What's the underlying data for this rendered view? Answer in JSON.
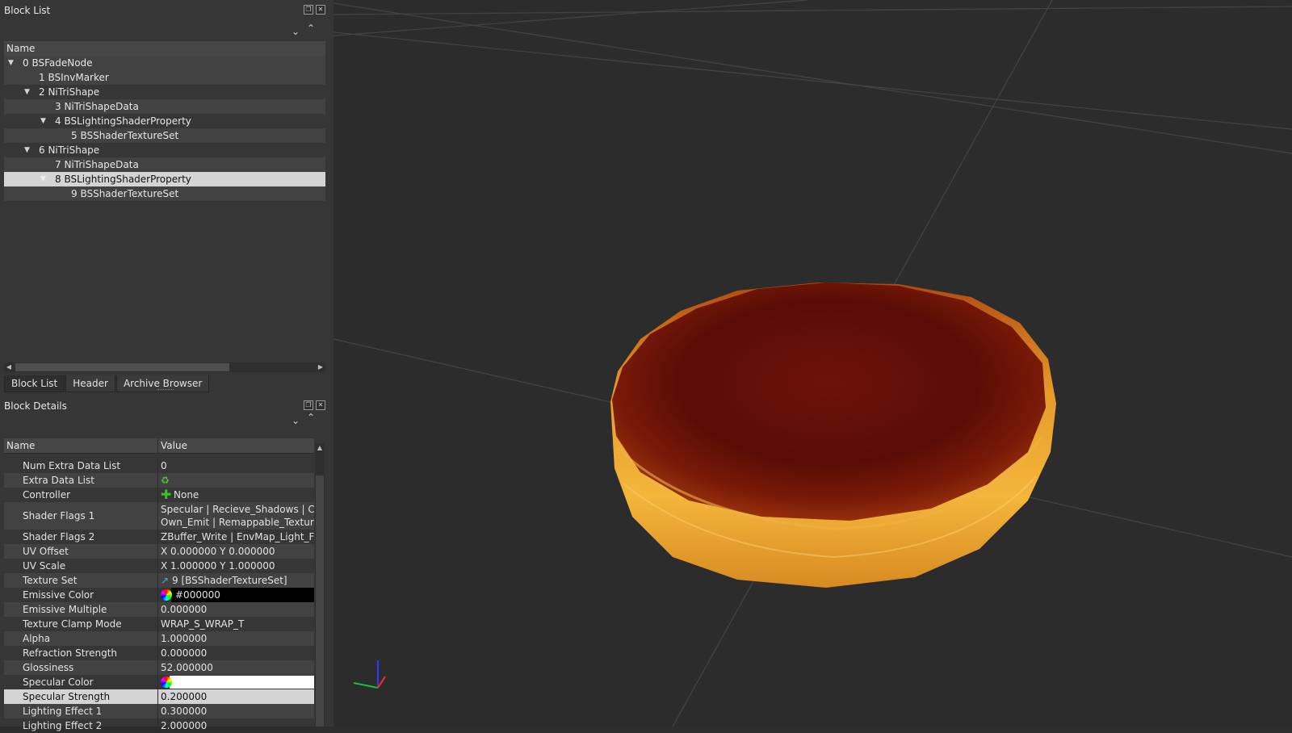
{
  "block_list": {
    "title": "Block List",
    "column_header": "Name",
    "items": [
      {
        "label": "0 BSFadeNode",
        "expanded": true
      },
      {
        "label": "1 BSInvMarker"
      },
      {
        "label": "2 NiTriShape",
        "expanded": true
      },
      {
        "label": "3 NiTriShapeData"
      },
      {
        "label": "4 BSLightingShaderProperty",
        "expanded": true
      },
      {
        "label": "5 BSShaderTextureSet"
      },
      {
        "label": "6 NiTriShape",
        "expanded": true
      },
      {
        "label": "7 NiTriShapeData"
      },
      {
        "label": "8 BSLightingShaderProperty",
        "expanded": true,
        "selected": true
      },
      {
        "label": "9 BSShaderTextureSet"
      }
    ],
    "tabs": [
      "Block List",
      "Header",
      "Archive Browser"
    ],
    "active_tab": "Block List"
  },
  "block_details": {
    "title": "Block Details",
    "columns": {
      "name": "Name",
      "value": "Value"
    },
    "rows": [
      {
        "name": "Num Extra Data List",
        "value": "0"
      },
      {
        "name": "Extra Data List",
        "value": ""
      },
      {
        "name": "Controller",
        "value": "None"
      },
      {
        "name": "Shader Flags 1",
        "value": "Specular | Recieve_Shadows | Cast_Sh",
        "value2": "Own_Emit | Remappable_Textures | Z"
      },
      {
        "name": "Shader Flags 2",
        "value": "ZBuffer_Write | EnvMap_Light_Fade"
      },
      {
        "name": "UV Offset",
        "value": "X 0.000000 Y 0.000000"
      },
      {
        "name": "UV Scale",
        "value": "X 1.000000 Y 1.000000"
      },
      {
        "name": "Texture Set",
        "value": "9 [BSShaderTextureSet]"
      },
      {
        "name": "Emissive Color",
        "value": "#000000",
        "swatch": "#000000"
      },
      {
        "name": "Emissive Multiple",
        "value": "0.000000"
      },
      {
        "name": "Texture Clamp Mode",
        "value": "WRAP_S_WRAP_T"
      },
      {
        "name": "Alpha",
        "value": "1.000000"
      },
      {
        "name": "Refraction Strength",
        "value": "0.000000"
      },
      {
        "name": "Glossiness",
        "value": "52.000000"
      },
      {
        "name": "Specular Color",
        "value": "",
        "swatch": "#ffffff"
      },
      {
        "name": "Specular Strength",
        "value": "0.200000",
        "selected": true
      },
      {
        "name": "Lighting Effect 1",
        "value": "0.300000"
      },
      {
        "name": "Lighting Effect 2",
        "value": "2.000000"
      }
    ]
  },
  "icons": {
    "collapse_all": "chevron-down-double-icon",
    "expand_all": "chevron-up-double-icon",
    "float": "float-icon",
    "close": "close-icon",
    "color_wheel": "color-wheel-icon",
    "plus": "plus-icon",
    "link": "link-icon"
  },
  "colors": {
    "selection": "#d4d4d4",
    "panel_bg": "#363636",
    "viewport_bg": "#2c2c2c",
    "emissive_swatch": "#000000",
    "specular_swatch": "#ffffff"
  }
}
